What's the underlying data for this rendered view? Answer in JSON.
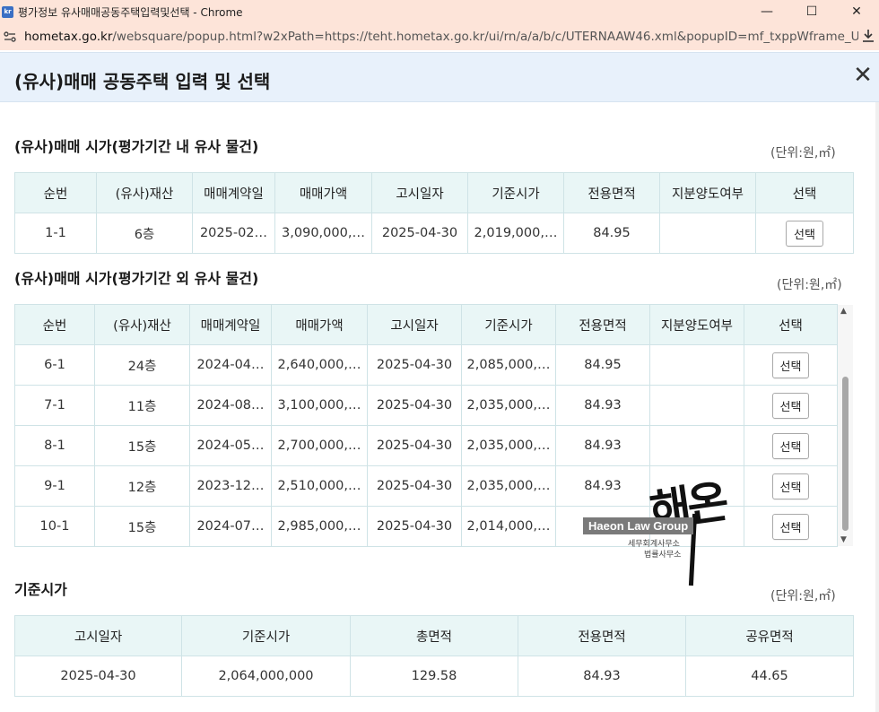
{
  "window": {
    "title": "평가정보 유사매매공동주택입력및선택 - Chrome",
    "favicon_text": "kr",
    "minimize": "—",
    "maximize": "☐",
    "close": "✕"
  },
  "urlbar": {
    "host": "hometax.go.kr",
    "path": "/websquare/popup.html?w2xPath=https://teht.hometax.go.kr/ui/rn/a/a/b/c/UTERNAAW46.xml&popupID=mf_txppWframe_UTE..."
  },
  "popup": {
    "title": "(유사)매매 공동주택 입력 및 선택",
    "close_label": "✕"
  },
  "section1": {
    "title": "(유사)매매 시가(평가기간 내 유사 물건)",
    "unit": "(단위:원,㎡)",
    "columns": [
      "순번",
      "(유사)재산",
      "매매계약일",
      "매매가액",
      "고시일자",
      "기준시가",
      "전용면적",
      "지분양도여부",
      "선택"
    ],
    "rows": [
      {
        "seq": "1-1",
        "property": "6층",
        "contract_date": "2025-02…",
        "price": "3,090,000,…",
        "notice_date": "2025-04-30",
        "base_price": "2,019,000,…",
        "area": "84.95",
        "share": "",
        "select": "선택"
      }
    ]
  },
  "section2": {
    "title": "(유사)매매 시가(평가기간 외 유사 물건)",
    "unit": "(단위:원,㎡)",
    "columns": [
      "순번",
      "(유사)재산",
      "매매계약일",
      "매매가액",
      "고시일자",
      "기준시가",
      "전용면적",
      "지분양도여부",
      "선택"
    ],
    "rows": [
      {
        "seq": "6-1",
        "property": "24층",
        "contract_date": "2024-04…",
        "price": "2,640,000,…",
        "notice_date": "2025-04-30",
        "base_price": "2,085,000,…",
        "area": "84.95",
        "share": "",
        "select": "선택"
      },
      {
        "seq": "7-1",
        "property": "11층",
        "contract_date": "2024-08…",
        "price": "3,100,000,…",
        "notice_date": "2025-04-30",
        "base_price": "2,035,000,…",
        "area": "84.93",
        "share": "",
        "select": "선택"
      },
      {
        "seq": "8-1",
        "property": "15층",
        "contract_date": "2024-05…",
        "price": "2,700,000,…",
        "notice_date": "2025-04-30",
        "base_price": "2,035,000,…",
        "area": "84.93",
        "share": "",
        "select": "선택"
      },
      {
        "seq": "9-1",
        "property": "12층",
        "contract_date": "2023-12…",
        "price": "2,510,000,…",
        "notice_date": "2025-04-30",
        "base_price": "2,035,000,…",
        "area": "84.93",
        "share": "",
        "select": "선택"
      },
      {
        "seq": "10-1",
        "property": "15층",
        "contract_date": "2024-07…",
        "price": "2,985,000,…",
        "notice_date": "2025-04-30",
        "base_price": "2,014,000,…",
        "area": "",
        "share": "",
        "select": "선택"
      }
    ],
    "scroll_up": "▲",
    "scroll_down": "▼"
  },
  "section3": {
    "title": "기준시가",
    "unit": "(단위:원,㎡)",
    "columns": [
      "고시일자",
      "기준시가",
      "총면적",
      "전용면적",
      "공유면적"
    ],
    "row": {
      "notice_date": "2025-04-30",
      "base_price": "2,064,000,000",
      "total_area": "129.58",
      "exclusive_area": "84.93",
      "shared_area": "44.65"
    }
  },
  "watermark": {
    "handwriting": "해온",
    "badge": "Haeon Law Group",
    "line1": "세무회계사무소",
    "line2": "법률사무소"
  },
  "colors": {
    "titlebar_bg": "#fde4d9",
    "header_bg": "#e8f1fb",
    "table_header_bg": "#e9f6f6",
    "table_border": "#cfe3e6"
  }
}
